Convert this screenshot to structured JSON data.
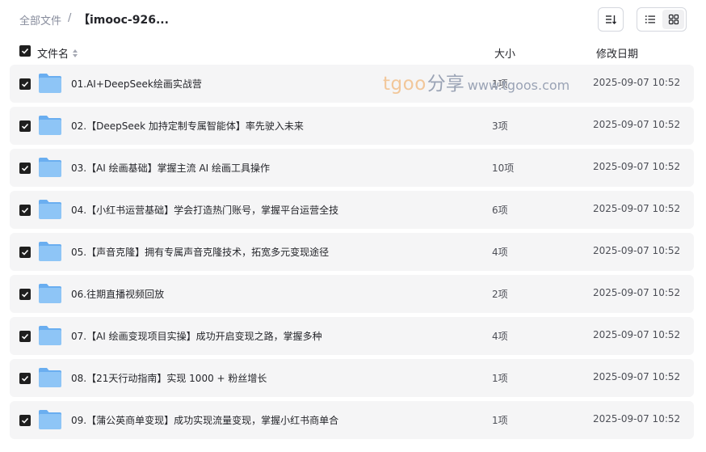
{
  "breadcrumb": {
    "root": "全部文件",
    "separator": "/",
    "current": "【imooc-926..."
  },
  "toolbar": {
    "sort_icon": "sort-icon",
    "list_view_icon": "list-view-icon",
    "grid_view_icon": "grid-view-icon"
  },
  "table": {
    "header": {
      "name": "文件名",
      "size": "大小",
      "date": "修改日期"
    },
    "rows": [
      {
        "name": "01.AI+DeepSeek绘画实战营",
        "size": "1项",
        "date": "2025-09-07 10:52"
      },
      {
        "name": "02.【DeepSeek 加持定制专属智能体】率先驶入未来",
        "size": "3项",
        "date": "2025-09-07 10:52"
      },
      {
        "name": "03.【AI 绘画基础】掌握主流 AI 绘画工具操作",
        "size": "10项",
        "date": "2025-09-07 10:52"
      },
      {
        "name": "04.【小红书运营基础】学会打造热门账号，掌握平台运营全技",
        "size": "6项",
        "date": "2025-09-07 10:52"
      },
      {
        "name": "05.【声音克隆】拥有专属声音克隆技术，拓宽多元变现途径",
        "size": "4项",
        "date": "2025-09-07 10:52"
      },
      {
        "name": "06.往期直播视频回放",
        "size": "2项",
        "date": "2025-09-07 10:52"
      },
      {
        "name": "07.【AI 绘画变现项目实操】成功开启变现之路，掌握多种",
        "size": "4项",
        "date": "2025-09-07 10:52"
      },
      {
        "name": "08.【21天行动指南】实现 1000 + 粉丝增长",
        "size": "1项",
        "date": "2025-09-07 10:52"
      },
      {
        "name": "09.【蒲公英商单变现】成功实现流量变现，掌握小红书商单合",
        "size": "1项",
        "date": "2025-09-07 10:52"
      }
    ]
  },
  "watermark": {
    "brand": "tgoo",
    "brand2": "分享",
    "url": "www.tgoos.com"
  },
  "colors": {
    "row_bg": "#f5f5f6",
    "folder": "#8ec5f6",
    "folder_dark": "#6aaef0",
    "checkbox": "#1f1f1f"
  }
}
